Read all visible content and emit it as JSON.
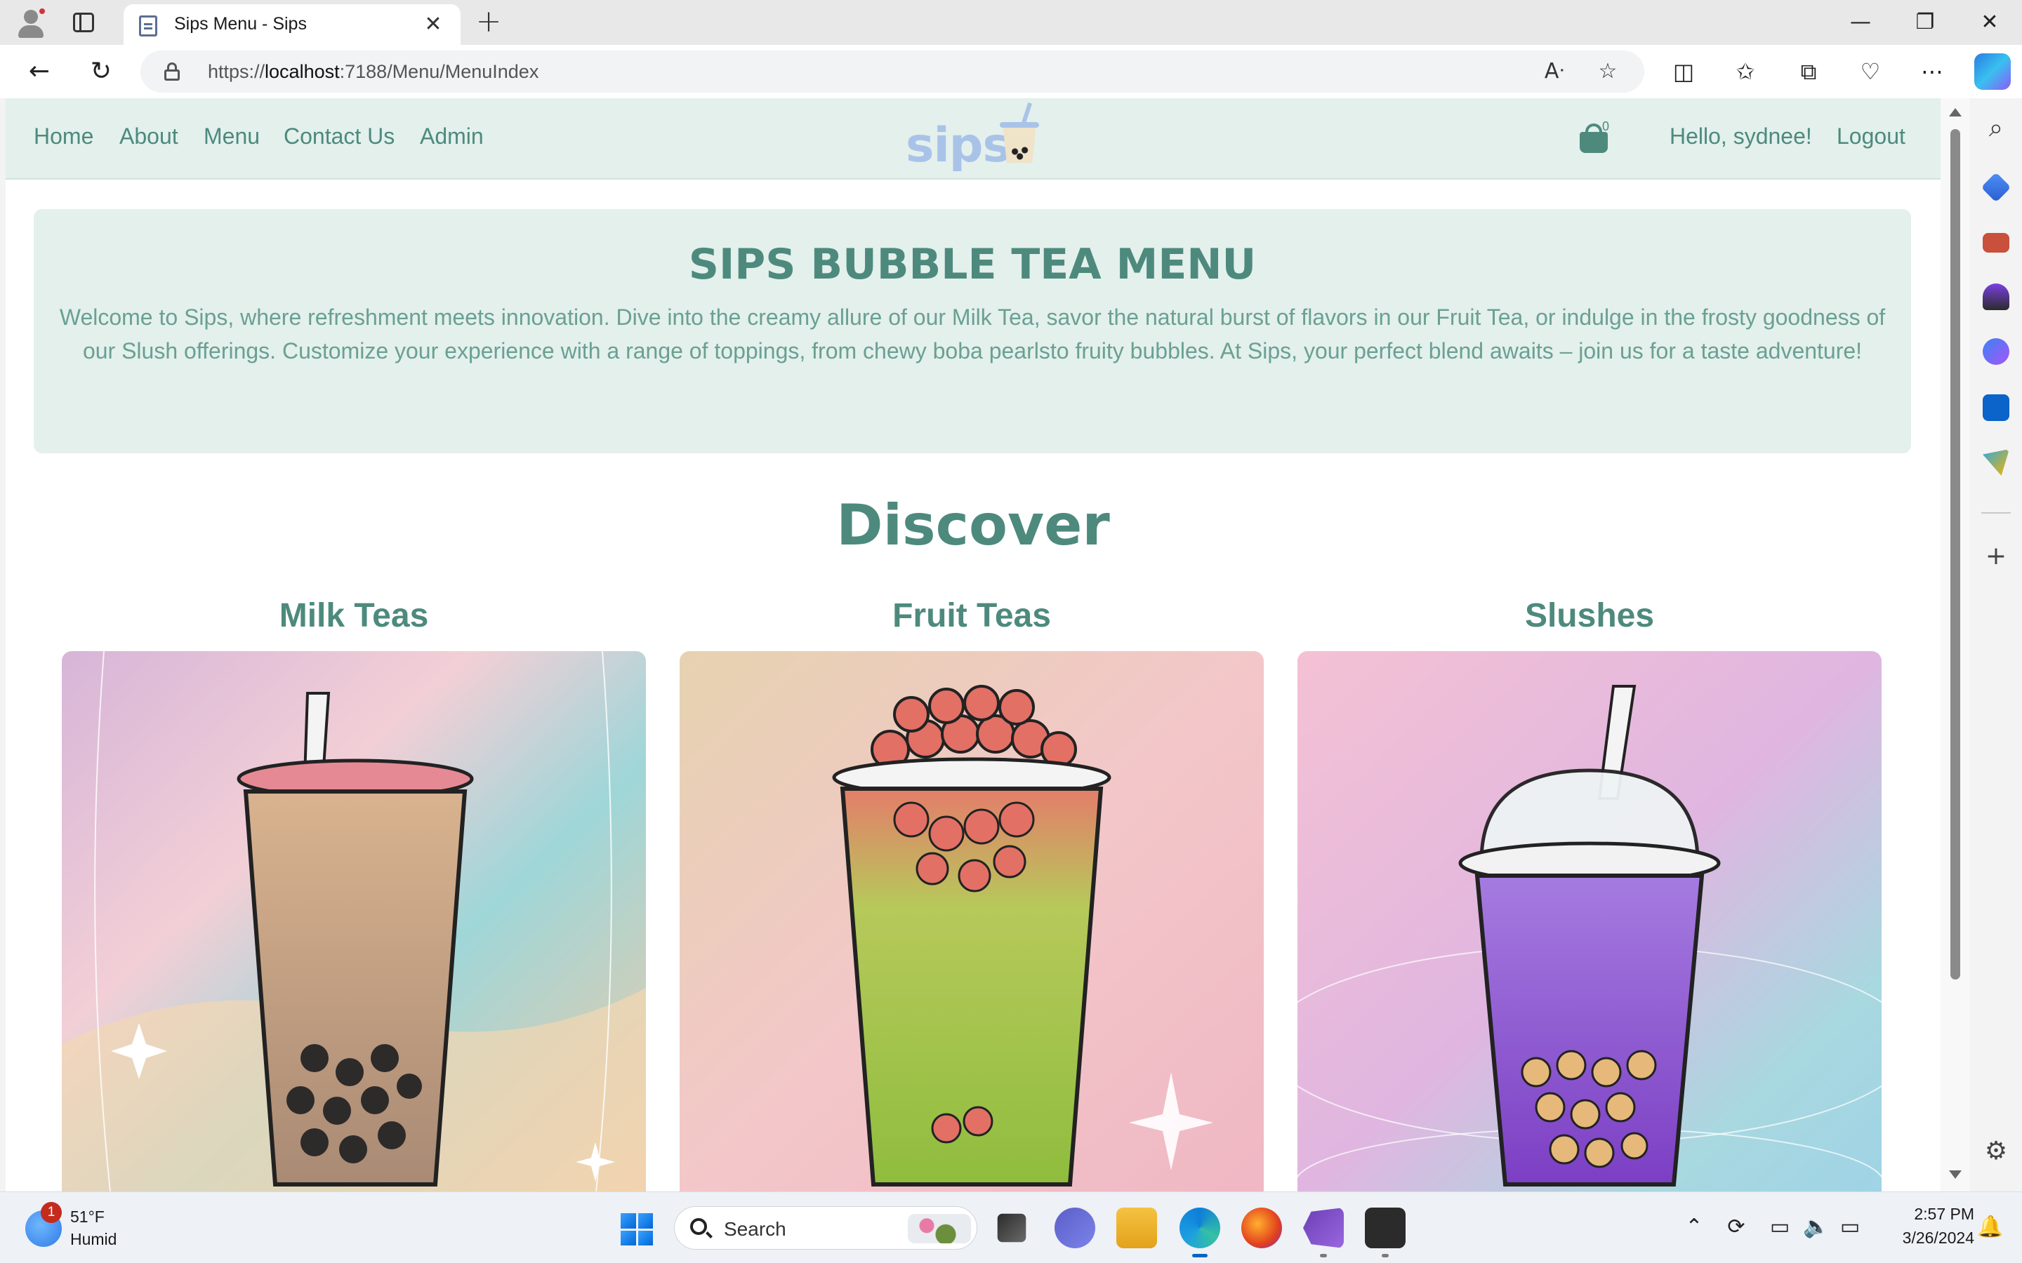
{
  "browser": {
    "tab": {
      "title": "Sips Menu - Sips",
      "close_glyph": "✕",
      "favicon": "page-icon"
    },
    "new_tab_glyph": "+",
    "window_controls": {
      "minimize": "—",
      "restore": "❐",
      "close": "✕"
    },
    "address": {
      "prefix": "https://",
      "host": "localhost",
      "rest": ":7188/Menu/MenuIndex"
    },
    "nav": {
      "back": "←",
      "reload": "↻"
    },
    "toolbar_icons": [
      "read-aloud-icon",
      "favorite-star-icon",
      "split-screen-icon",
      "favorites-icon",
      "collections-icon",
      "browser-essentials-icon",
      "more-icon",
      "copilot-icon"
    ]
  },
  "site": {
    "nav": [
      "Home",
      "About",
      "Menu",
      "Contact Us",
      "Admin"
    ],
    "logo_text": "sips",
    "cart_count": "0",
    "greeting": "Hello, sydnee!",
    "logout": "Logout"
  },
  "hero": {
    "title": "SIPS BUBBLE TEA MENU",
    "text": "Welcome to Sips, where refreshment meets innovation. Dive into the creamy allure of our Milk Tea, savor the natural burst of flavors in our Fruit Tea, or indulge in the frosty goodness of our Slush offerings. Customize your experience with a range of toppings, from chewy boba pearlsto fruity bubbles. At Sips, your perfect blend awaits – join us for a taste adventure!"
  },
  "discover": {
    "title": "Discover",
    "categories": [
      {
        "name": "Milk Teas",
        "image": "milk-tea-illustration"
      },
      {
        "name": "Fruit Teas",
        "image": "fruit-tea-illustration"
      },
      {
        "name": "Slushes",
        "image": "slush-illustration"
      }
    ]
  },
  "taskbar": {
    "weather": {
      "badge": "1",
      "temp": "51°F",
      "desc": "Humid"
    },
    "search_label": "Search",
    "clock": {
      "time": "2:57 PM",
      "date": "3/26/2024"
    }
  },
  "colors": {
    "brand_green": "#4d8a7d",
    "nav_bg": "#e3f0ec",
    "logo_blue": "#a9c3e8"
  }
}
